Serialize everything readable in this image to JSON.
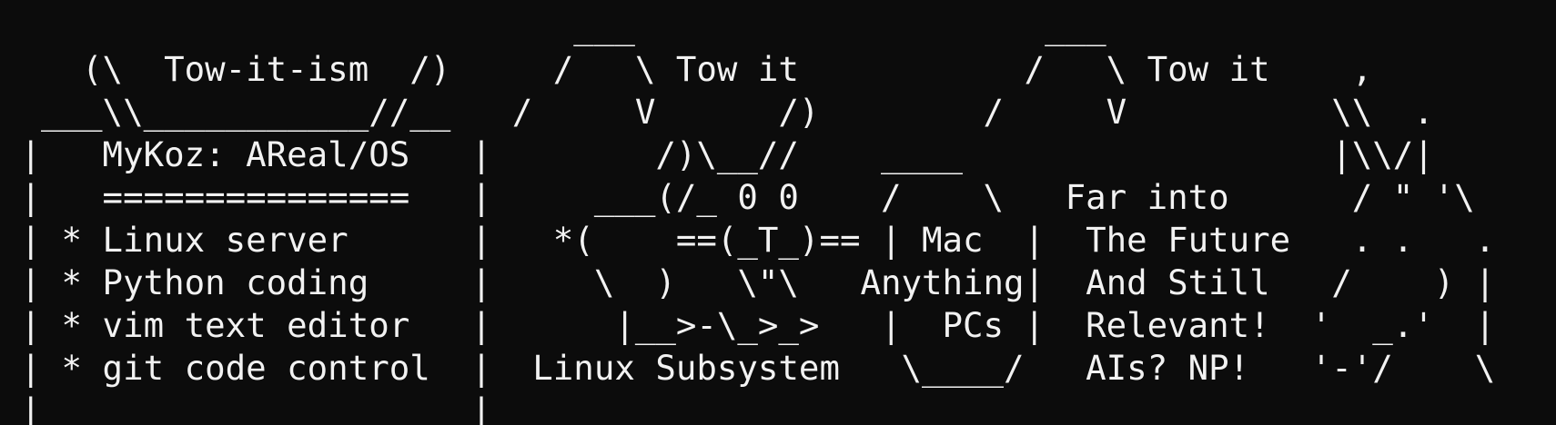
{
  "terminal": {
    "background_color": "#0c0c0c",
    "text_color": "#f2f2f2",
    "lines": [
      "                            ___                    ___",
      "    (\\  Tow-it-ism  /)     /   \\ Tow it           /   \\ Tow it    ,",
      "  ___\\\\___________//__   /     V      /)        /     V          \\\\  .",
      " |   MyKoz: AReal/OS   |        /)\\__//    ____                  |\\\\/|",
      " |   ===============   |     ___(/_ 0 0    /    \\   Far into      / \" '\\",
      " | * Linux server      |   *(    ==(_T_)== | Mac  |  The Future   . .   .",
      " | * Python coding     |     \\  )   \\\"\\   Anything|  And Still   /    ) |",
      " | * vim text editor   |      |__>-\\_>_>   |  PCs |  Relevant!  '  _.'  |",
      " | * git code control  |  Linux Subsystem   \\____/   AIs? NP!   '-'/    \\",
      " |_____________________|"
    ]
  }
}
